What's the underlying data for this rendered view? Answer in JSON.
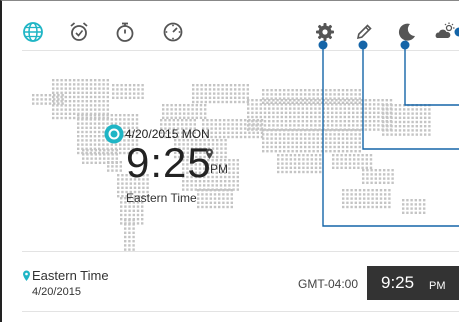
{
  "toolbar": {
    "left_icons": [
      "world-clock-icon",
      "alarm-icon",
      "stopwatch-icon",
      "timer-icon"
    ],
    "right_icons": [
      "settings-icon",
      "edit-icon",
      "night-mode-icon",
      "weather-icon"
    ],
    "active_color": "#1fb5c5"
  },
  "main_clock": {
    "date": "4/20/2015 MON",
    "time": "9:25",
    "ampm": "PM",
    "timezone": "Eastern Time"
  },
  "city_list": [
    {
      "name": "Eastern Time",
      "date": "4/20/2015",
      "gmt": "GMT-04:00",
      "time": "9:25",
      "ampm": "PM"
    }
  ],
  "colors": {
    "accent": "#1fb5c5",
    "callout": "#1565a8",
    "map_dot": "#c4c4c4",
    "time_box_bg": "#333333"
  }
}
